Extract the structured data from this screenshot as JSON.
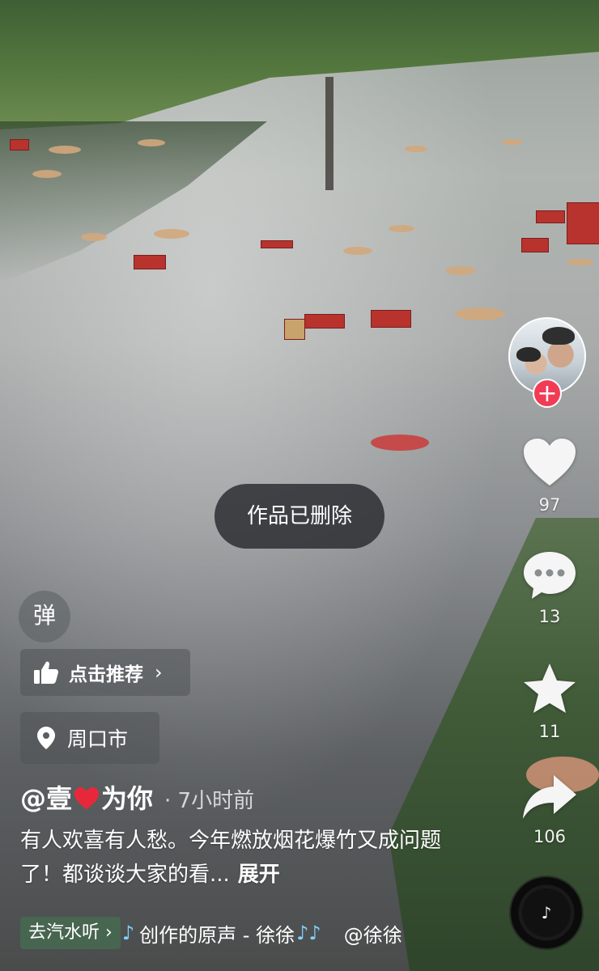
{
  "toast": {
    "text": "作品已删除"
  },
  "creator": {
    "follow_symbol": "+"
  },
  "actions": {
    "like_count": "97",
    "comment_count": "13",
    "favorite_count": "11",
    "share_count": "106"
  },
  "danmu": {
    "label": "弹"
  },
  "recommend": {
    "label": "点击推荐",
    "arrow": "›"
  },
  "location": {
    "label": "周口市"
  },
  "post": {
    "author_prefix": "@壹",
    "author_suffix": "为你",
    "time_ago": "· 7小时前",
    "description": "有人欢喜有人愁。今年燃放烟花爆竹又成问题了！都谈谈大家的看...",
    "expand_label": "展开"
  },
  "music": {
    "chip_label": "去汽水听",
    "chip_arrow": "›",
    "note": "♪",
    "title": "创作的原声 - 徐徐",
    "note_end": "♪♪",
    "at_user": "@徐徐"
  },
  "colors": {
    "follow": "#f13c56",
    "heart_emoji": "#e8283a",
    "music_note": "#7fd3ff",
    "music_chip": "#466e50"
  },
  "icons": {
    "like": "heart-icon",
    "comment": "comment-bubble-icon",
    "favorite": "star-icon",
    "share": "share-arrow-icon",
    "recommend": "thumbs-up-icon",
    "location": "location-pin-icon",
    "disc": "music-disc-icon"
  }
}
